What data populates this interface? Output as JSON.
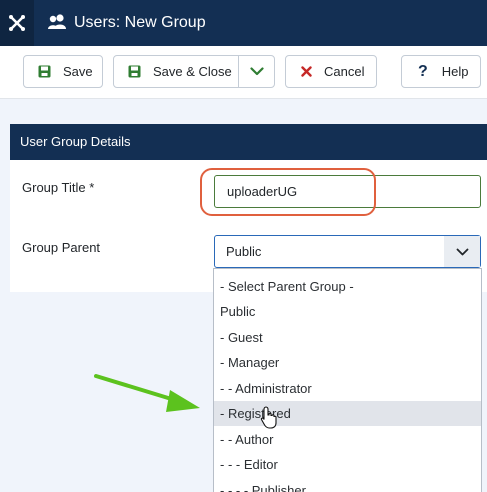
{
  "header": {
    "title": "Users: New Group",
    "logo_icon": "joomla-logo-icon",
    "page_icon": "users-icon"
  },
  "toolbar": {
    "save_label": "Save",
    "save_close_label": "Save & Close",
    "cancel_label": "Cancel",
    "help_label": "Help"
  },
  "form": {
    "section_title": "User Group Details",
    "group_title_label": "Group Title *",
    "group_title_value": "uploaderUG",
    "group_parent_label": "Group Parent",
    "group_parent_value": "Public"
  },
  "dropdown": {
    "options": [
      "- Select Parent Group -",
      "Public",
      "- Guest",
      "- Manager",
      "- - Administrator",
      "- Registered",
      "- - Author",
      "- - - Editor",
      "- - - - Publisher"
    ],
    "highlighted_index": 5
  },
  "colors": {
    "header_bg": "#132f53",
    "highlight_ring": "#e0603e",
    "annotation_arrow": "#5cc21e",
    "cancel_icon": "#c52827",
    "save_icon": "#2f7d32"
  }
}
